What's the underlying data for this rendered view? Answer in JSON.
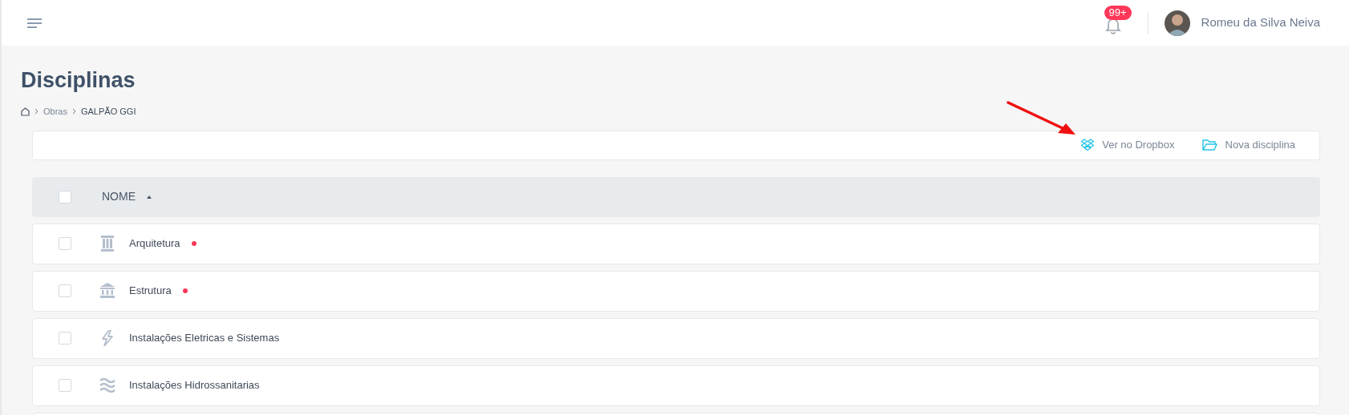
{
  "header": {
    "notifications_badge": "99+",
    "user_name": "Romeu da Silva Neiva"
  },
  "page": {
    "title": "Disciplinas",
    "breadcrumb": [
      "Obras",
      "GALPÃO GGI"
    ]
  },
  "toolbar": {
    "actions": [
      {
        "kind": "dropbox",
        "label": "Ver no Dropbox"
      },
      {
        "kind": "folder",
        "label": "Nova disciplina"
      }
    ]
  },
  "table": {
    "columns": [
      {
        "label": "NOME",
        "sorted": true
      }
    ],
    "header_checked": false,
    "rows": [
      {
        "kind": "column",
        "name": "Arquitetura",
        "checked": false,
        "flagged": true
      },
      {
        "kind": "bank",
        "name": "Estrutura",
        "checked": false,
        "flagged": true
      },
      {
        "kind": "bolt",
        "name": "Instalações Eletricas e Sistemas",
        "checked": false,
        "flagged": false
      },
      {
        "kind": "waves",
        "name": "Instalações Hidrossanitarias",
        "checked": false,
        "flagged": false
      }
    ]
  }
}
